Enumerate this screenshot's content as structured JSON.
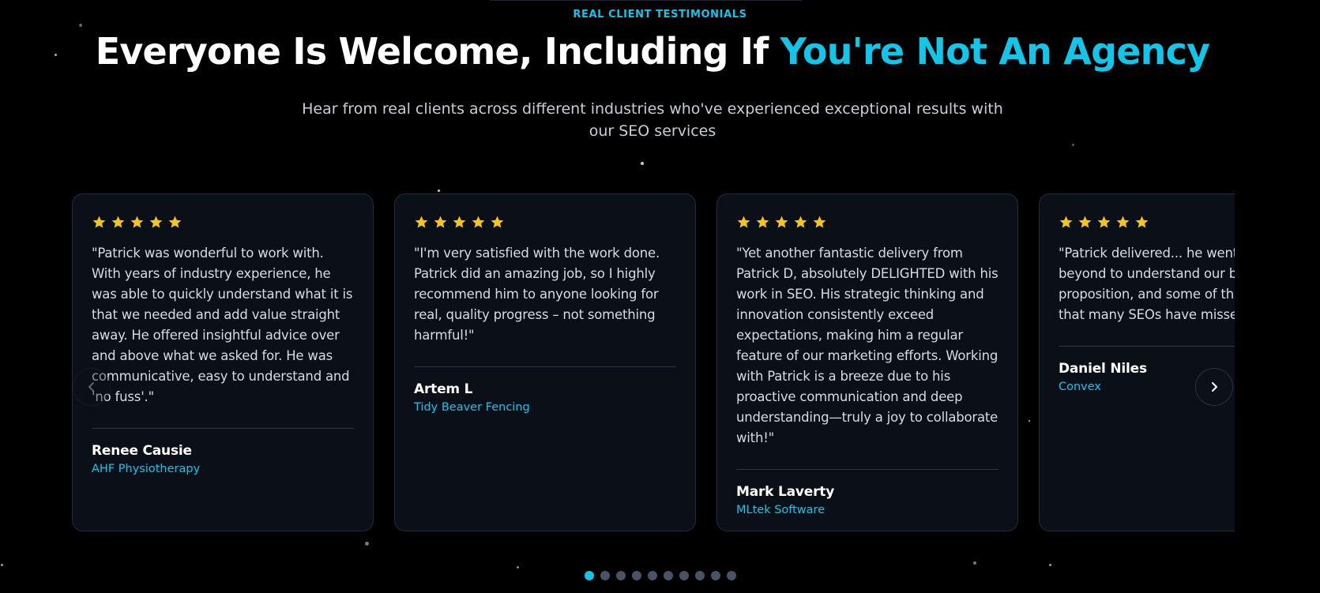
{
  "section": {
    "eyebrow": "REAL CLIENT TESTIMONIALS",
    "headline_white": "Everyone Is Welcome, Including If ",
    "headline_accent": "You're Not An Agency",
    "subheadline": "Hear from real clients across different industries who've experienced exceptional results with our SEO services"
  },
  "colors": {
    "accent": "#12c6ea",
    "star": "#f5c518",
    "card_bg": "#0b0f17",
    "page_bg": "#000000"
  },
  "testimonials": [
    {
      "rating": 5,
      "quote": "\"Patrick was wonderful to work with. With years of industry experience, he was able to quickly understand what it is that we needed and add value straight away. He offered insightful advice over and above what we asked for. He was communicative, easy to understand and 'no fuss'.\"",
      "author": "Renee Causie",
      "company": "AHF Physiotherapy"
    },
    {
      "rating": 5,
      "quote": "\"I'm very satisfied with the work done. Patrick did an amazing job, so I highly recommend him to anyone looking for real, quality progress – not something harmful!\"",
      "author": "Artem L",
      "company": "Tidy Beaver Fencing"
    },
    {
      "rating": 5,
      "quote": "\"Yet another fantastic delivery from Patrick D, absolutely DELIGHTED with his work in SEO. His strategic thinking and innovation consistently exceed expectations, making him a regular feature of our marketing efforts. Working with Patrick is a breeze due to his proactive communication and deep understanding—truly a joy to collaborate with!\"",
      "author": "Mark Laverty",
      "company": "MLtek Software"
    },
    {
      "rating": 5,
      "quote": "\"Patrick delivered... he went above and beyond to understand our business proposition, and some of the nuances that many SEOs have missed",
      "author": "Daniel Niles",
      "company": "Convex"
    }
  ],
  "carousel": {
    "prev_icon": "chevron-left-icon",
    "next_icon": "chevron-right-icon",
    "total_slides": 10,
    "active_slide": 1
  }
}
